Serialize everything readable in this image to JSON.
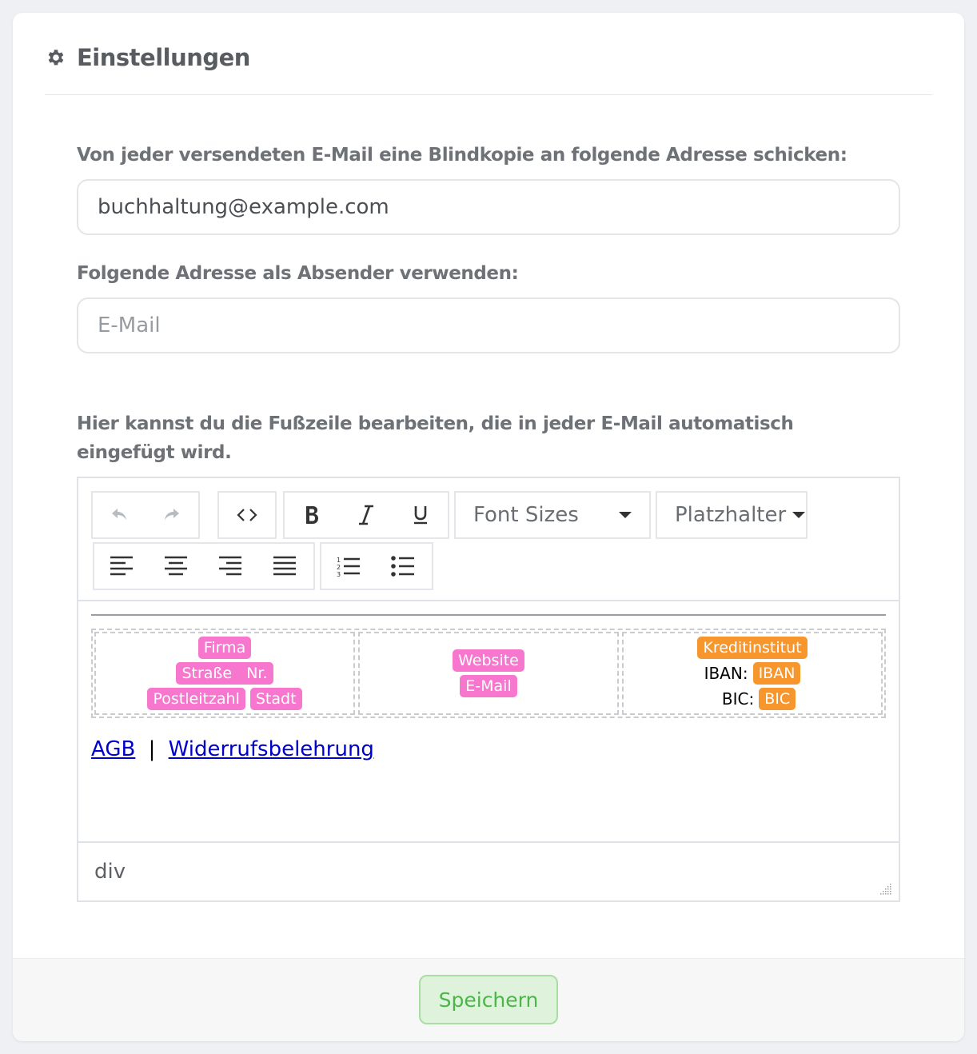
{
  "header": {
    "title": "Einstellungen",
    "icon": "gear-icon"
  },
  "bcc": {
    "label": "Von jeder versendeten E-Mail eine Blindkopie an folgende Adresse schicken:",
    "value": "buchhaltung@example.com"
  },
  "sender": {
    "label": "Folgende Adresse als Absender verwenden:",
    "placeholder": "E-Mail",
    "value": ""
  },
  "footer_editor": {
    "label_line1": "Hier kannst du die Fußzeile bearbeiten, die in jeder E-Mail automatisch",
    "label_line2": "eingefügt wird.",
    "toolbar": {
      "font_sizes": "Font Sizes",
      "placeholders": "Platzhalter"
    },
    "columns": {
      "firma": "Firma",
      "strasse": "Straße",
      "nr": "Nr.",
      "plz": "Postleitzahl",
      "stadt": "Stadt",
      "website": "Website",
      "email": "E-Mail",
      "kreditinstitut": "Kreditinstitut",
      "iban_label": "IBAN:",
      "iban": "IBAN",
      "bic_label": "BIC:",
      "bic": "BIC"
    },
    "links": {
      "agb": "AGB",
      "separator": "|",
      "widerruf": "Widerrufsbelehrung"
    },
    "status_path": "div"
  },
  "actions": {
    "save": "Speichern"
  },
  "colors": {
    "placeholder_pink": "#f877ce",
    "placeholder_orange": "#f8962e",
    "save_green": "#4cb547"
  }
}
